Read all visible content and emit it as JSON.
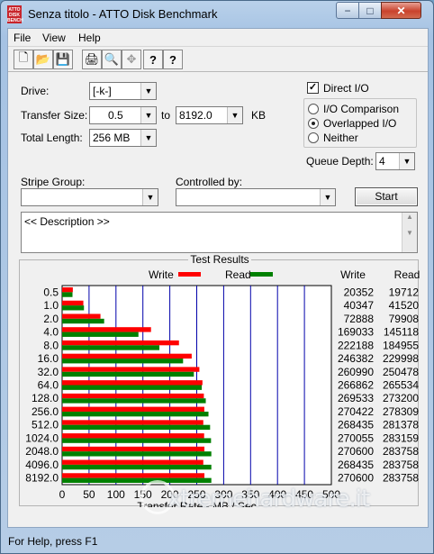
{
  "window": {
    "title": "Senza titolo - ATTO Disk Benchmark",
    "icon_label": "ATTO DISK BENCH",
    "min_glyph": "−",
    "max_glyph": "□",
    "close_glyph": "✕"
  },
  "menu": [
    "File",
    "View",
    "Help"
  ],
  "toolbar": {
    "icons": [
      "new-file-icon",
      "open-folder-icon",
      "save-icon",
      "print-icon",
      "print-preview-icon",
      "move-icon",
      "help-icon",
      "context-help-icon"
    ],
    "glyphs": [
      "🗋",
      "📂",
      "💾",
      "🖨",
      "🔍",
      "✥",
      "?",
      "?"
    ]
  },
  "drive": {
    "label": "Drive:",
    "value": "[-k-]"
  },
  "transfer_size": {
    "label": "Transfer Size:",
    "from": "0.5",
    "to_label": "to",
    "to": "8192.0",
    "unit": "KB"
  },
  "total_length": {
    "label": "Total Length:",
    "value": "256 MB"
  },
  "direct_io": {
    "label": "Direct I/O",
    "checked": true,
    "mark": "✓"
  },
  "io_mode": {
    "options": [
      "I/O Comparison",
      "Overlapped I/O",
      "Neither"
    ],
    "selected": "Overlapped I/O"
  },
  "queue_depth": {
    "label": "Queue Depth:",
    "value": "4"
  },
  "stripe_group": {
    "label": "Stripe Group:",
    "value": ""
  },
  "controlled_by": {
    "label": "Controlled by:",
    "value": ""
  },
  "start_button": "Start",
  "description": "<< Description >>",
  "results_title": "Test Results",
  "status": "For Help, press F1",
  "watermark": "xtremehardware.it",
  "colors": {
    "write": "#ff0000",
    "read": "#008000",
    "gridline": "#0000aa"
  },
  "chart_data": {
    "type": "bar",
    "orientation": "horizontal",
    "categories": [
      "0.5",
      "1.0",
      "2.0",
      "4.0",
      "8.0",
      "16.0",
      "32.0",
      "64.0",
      "128.0",
      "256.0",
      "512.0",
      "1024.0",
      "2048.0",
      "4096.0",
      "8192.0"
    ],
    "series": [
      {
        "name": "Write",
        "values": [
          20352,
          40347,
          72888,
          169033,
          222188,
          246382,
          260990,
          266862,
          269533,
          270422,
          268435,
          270055,
          270600,
          268435,
          270600
        ]
      },
      {
        "name": "Read",
        "values": [
          19712,
          41520,
          79908,
          145118,
          184955,
          229998,
          250478,
          265534,
          273200,
          278309,
          281378,
          283159,
          283758,
          283758,
          283758
        ]
      }
    ],
    "value_columns": [
      "Write",
      "Read"
    ],
    "xlabel": "Transfer Rate - MB / Sec",
    "xticks": [
      0,
      50,
      100,
      150,
      200,
      250,
      300,
      350,
      400,
      450,
      500
    ],
    "xlim": [
      0,
      500
    ],
    "legend": "top"
  }
}
